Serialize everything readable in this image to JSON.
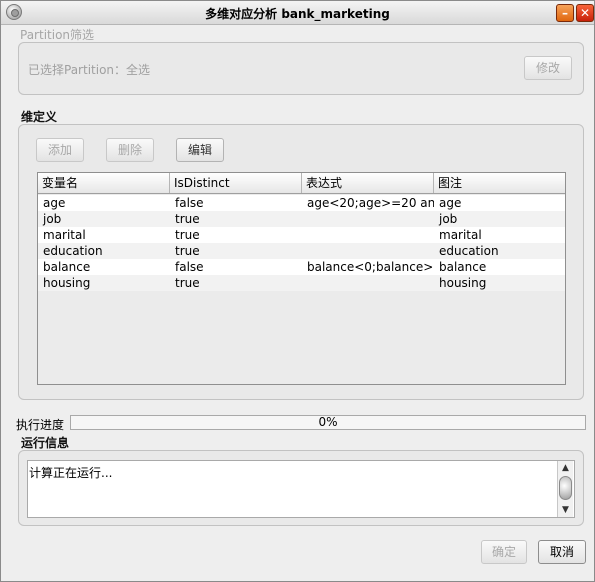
{
  "window": {
    "title": "多维对应分析 bank_marketing"
  },
  "partition": {
    "legend": "Partition筛选",
    "selected_label": "已选择Partition：全选",
    "modify_label": "修改"
  },
  "dimension": {
    "legend": "维定义",
    "add_label": "添加",
    "delete_label": "删除",
    "edit_label": "编辑",
    "columns": [
      "变量名",
      "IsDistinct",
      "表达式",
      "图注"
    ],
    "rows": [
      [
        "age",
        "false",
        "age<20;age>=20 an...",
        "age"
      ],
      [
        "job",
        "true",
        "",
        "job"
      ],
      [
        "marital",
        "true",
        "",
        "marital"
      ],
      [
        "education",
        "true",
        "",
        "education"
      ],
      [
        "balance",
        "false",
        "balance<0;balance>...",
        "balance"
      ],
      [
        "housing",
        "true",
        "",
        "housing"
      ]
    ]
  },
  "progress": {
    "label": "执行进度",
    "value": 0,
    "text": "0%"
  },
  "run_info": {
    "legend": "运行信息",
    "text": "计算正在运行..."
  },
  "footer": {
    "ok_label": "确定",
    "cancel_label": "取消"
  }
}
